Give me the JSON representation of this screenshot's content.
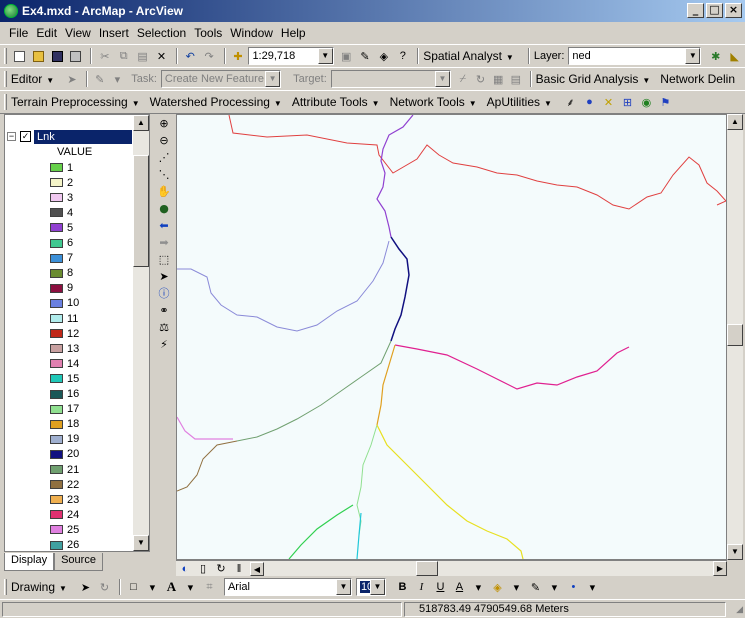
{
  "window": {
    "title": "Ex4.mxd - ArcMap - ArcView"
  },
  "menu": [
    "File",
    "Edit",
    "View",
    "Insert",
    "Selection",
    "Tools",
    "Window",
    "Help"
  ],
  "standard": {
    "scale": "1:29,718",
    "spatial_analyst": "Spatial Analyst",
    "layer_label": "Layer:",
    "layer_value": "ned"
  },
  "editor": {
    "editor_label": "Editor",
    "task_label": "Task:",
    "task_value": "Create New Feature",
    "target_label": "Target:",
    "basic_grid": "Basic Grid Analysis",
    "network_delin": "Network Delin"
  },
  "hydro": {
    "terrain": "Terrain Preprocessing",
    "watershed": "Watershed Processing",
    "attribute": "Attribute Tools",
    "network": "Network Tools",
    "aputilities": "ApUtilities"
  },
  "toc": {
    "layer_name": "Lnk",
    "field_header": "VALUE",
    "items": [
      {
        "label": "1",
        "color": "#66d04a"
      },
      {
        "label": "2",
        "color": "#f4f4c8"
      },
      {
        "label": "3",
        "color": "#f0c8f0"
      },
      {
        "label": "4",
        "color": "#505050"
      },
      {
        "label": "5",
        "color": "#9040d0"
      },
      {
        "label": "6",
        "color": "#40c890"
      },
      {
        "label": "7",
        "color": "#3c90d8"
      },
      {
        "label": "8",
        "color": "#6a8c30"
      },
      {
        "label": "9",
        "color": "#8c1040"
      },
      {
        "label": "10",
        "color": "#6a80e0"
      },
      {
        "label": "11",
        "color": "#b0ecec"
      },
      {
        "label": "12",
        "color": "#c02818"
      },
      {
        "label": "13",
        "color": "#c8a0a0"
      },
      {
        "label": "14",
        "color": "#e080b0"
      },
      {
        "label": "15",
        "color": "#20c8b8"
      },
      {
        "label": "16",
        "color": "#1a5858"
      },
      {
        "label": "17",
        "color": "#90e090"
      },
      {
        "label": "18",
        "color": "#e0a020"
      },
      {
        "label": "19",
        "color": "#a0b0d0"
      },
      {
        "label": "20",
        "color": "#101080"
      },
      {
        "label": "21",
        "color": "#70a070"
      },
      {
        "label": "22",
        "color": "#907040"
      },
      {
        "label": "23",
        "color": "#f0b050"
      },
      {
        "label": "24",
        "color": "#e03070"
      },
      {
        "label": "25",
        "color": "#e080e0"
      },
      {
        "label": "26",
        "color": "#40a0a0"
      }
    ],
    "tab_display": "Display",
    "tab_source": "Source"
  },
  "drawing": {
    "label": "Drawing",
    "font": "Arial",
    "size": "10"
  },
  "status": {
    "coords": "518783.49  4790549.68 Meters"
  },
  "colors": {
    "title_start": "#0a246a",
    "title_end": "#a6caf0",
    "map_bg": "#f4fbfc"
  }
}
